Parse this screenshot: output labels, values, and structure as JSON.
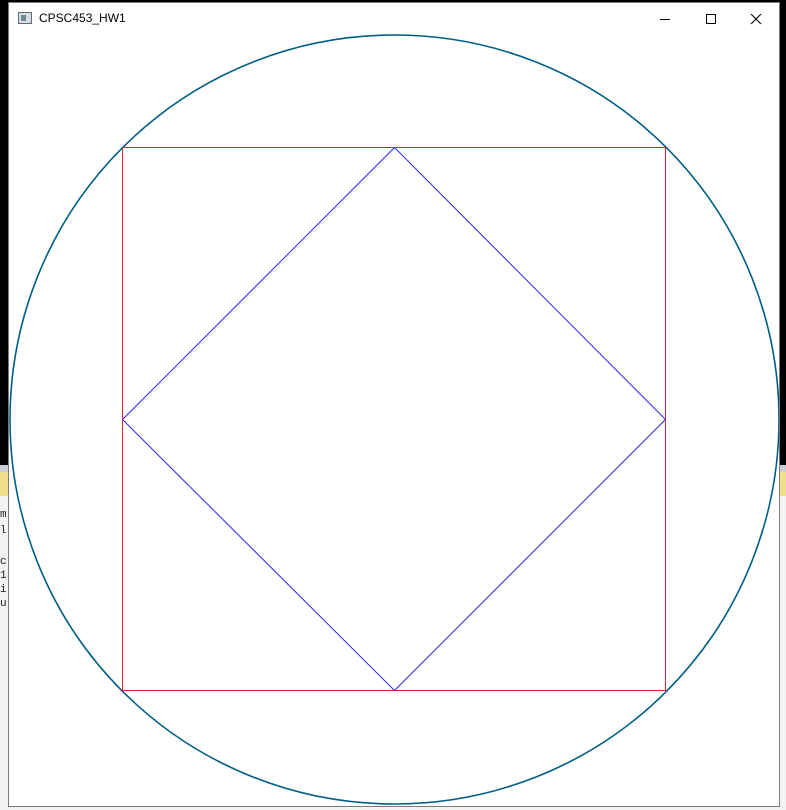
{
  "window": {
    "title": "CPSC453_HW1",
    "controls": [
      "minimize-icon",
      "maximize-icon",
      "close-icon"
    ]
  },
  "background_console_glyphs": [
    "m",
    "l",
    "",
    "c",
    "1",
    "i",
    "u"
  ],
  "drawing": {
    "shapes": [
      "circle",
      "square",
      "diamond"
    ],
    "colors": {
      "circle": "#005f87",
      "square": "#e0202a",
      "diamond": "#2a2ae6"
    }
  }
}
